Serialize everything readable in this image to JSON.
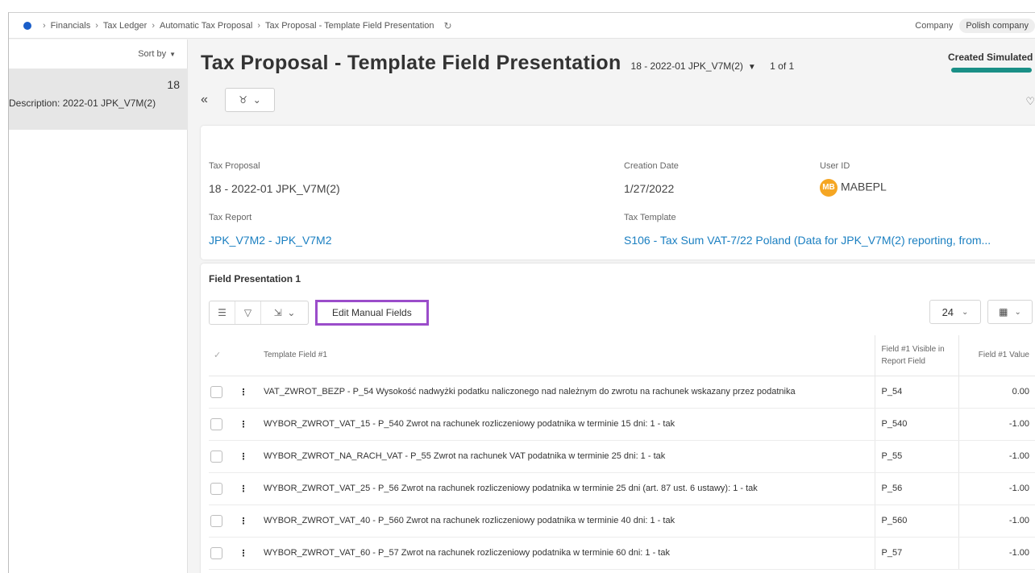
{
  "breadcrumb": {
    "items": [
      "Financials",
      "Tax Ledger",
      "Automatic Tax Proposal",
      "Tax Proposal - Template Field Presentation"
    ]
  },
  "company": {
    "label": "Company",
    "value": "Polish company"
  },
  "list": {
    "sort_label": "Sort by",
    "items": [
      {
        "id": "18",
        "description_label": "Description:",
        "description": "2022-01 JPK_V7M(2)"
      }
    ]
  },
  "header": {
    "title": "Tax Proposal - Template Field Presentation",
    "record": "18 - 2022-01 JPK_V7M(2)",
    "count": "1 of 1",
    "status": "Created Simulated"
  },
  "details": {
    "tax_proposal_label": "Tax Proposal",
    "tax_proposal": "18 - 2022-01 JPK_V7M(2)",
    "creation_date_label": "Creation Date",
    "creation_date": "1/27/2022",
    "user_id_label": "User ID",
    "user_initials": "MB",
    "user_id": "MABEPL",
    "tax_report_label": "Tax Report",
    "tax_report": "JPK_V7M2 - JPK_V7M2",
    "tax_template_label": "Tax Template",
    "tax_template": "S106 - Tax Sum VAT-7/22 Poland (Data for JPK_V7M(2) reporting, from..."
  },
  "field_presentation": {
    "title": "Field Presentation 1",
    "edit_button": "Edit Manual Fields",
    "page_size": "24",
    "columns": [
      "Template Field #1",
      "Field #1 Visible in Report Field",
      "Field #1 Value"
    ],
    "rows": [
      {
        "field": "VAT_ZWROT_BEZP - P_54 Wysokość nadwyżki podatku naliczonego nad należnym do zwrotu na rachunek wskazany przez podatnika",
        "report_field": "P_54",
        "value": "0.00"
      },
      {
        "field": "WYBOR_ZWROT_VAT_15 - P_540 Zwrot na rachunek rozliczeniowy podatnika w terminie 15 dni: 1 - tak",
        "report_field": "P_540",
        "value": "-1.00"
      },
      {
        "field": "WYBOR_ZWROT_NA_RACH_VAT - P_55 Zwrot na rachunek VAT podatnika w terminie 25 dni: 1 - tak",
        "report_field": "P_55",
        "value": "-1.00"
      },
      {
        "field": "WYBOR_ZWROT_VAT_25 - P_56 Zwrot na rachunek rozliczeniowy podatnika w terminie 25 dni (art. 87 ust. 6 ustawy): 1 - tak",
        "report_field": "P_56",
        "value": "-1.00"
      },
      {
        "field": "WYBOR_ZWROT_VAT_40 - P_560 Zwrot na rachunek rozliczeniowy podatnika w terminie 40 dni: 1 - tak",
        "report_field": "P_560",
        "value": "-1.00"
      },
      {
        "field": "WYBOR_ZWROT_VAT_60 - P_57 Zwrot na rachunek rozliczeniowy podatnika w terminie 60 dni: 1 - tak",
        "report_field": "P_57",
        "value": "-1.00"
      }
    ]
  },
  "colors": {
    "accent": "#1a8f86",
    "link": "#1a7fc1",
    "highlight": "#9b4dca",
    "avatar": "#f5a623"
  }
}
